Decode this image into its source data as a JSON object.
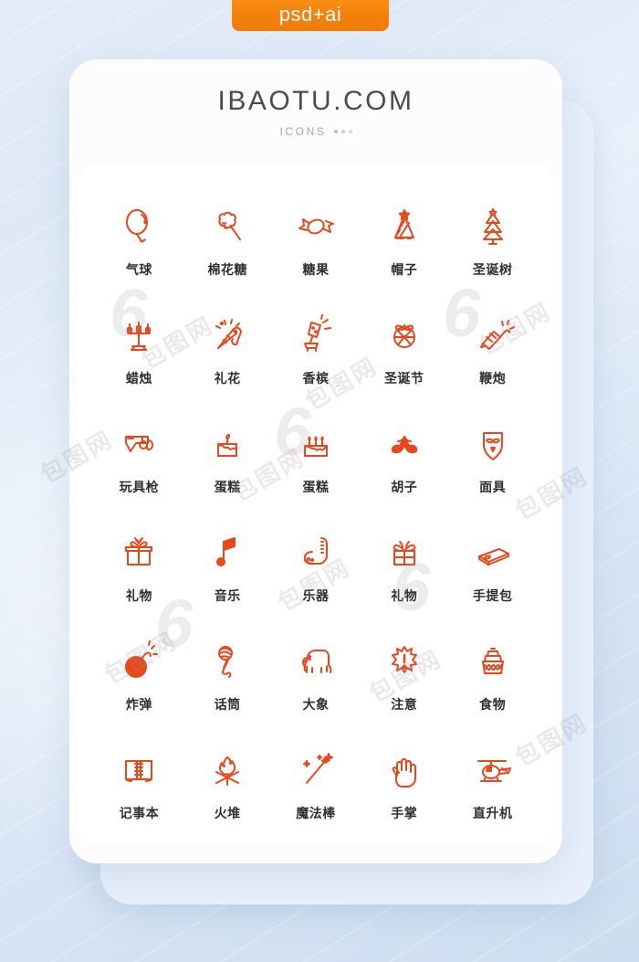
{
  "badge": {
    "label": "psd+ai",
    "color": "#f5820d"
  },
  "card": {
    "title": "IBAOTU.COM",
    "subtitle": "ICONS",
    "accent_color": "#e8481b",
    "title_color": "#4c4c4c"
  },
  "watermark": {
    "text": "包图网",
    "mark": "6"
  },
  "icons": [
    {
      "label": "气球",
      "name": "balloon-icon"
    },
    {
      "label": "棉花糖",
      "name": "cotton-candy-icon"
    },
    {
      "label": "糖果",
      "name": "candy-icon"
    },
    {
      "label": "帽子",
      "name": "party-hat-icon"
    },
    {
      "label": "圣诞树",
      "name": "christmas-tree-icon"
    },
    {
      "label": "蜡烛",
      "name": "candelabra-icon"
    },
    {
      "label": "礼花",
      "name": "party-popper-icon"
    },
    {
      "label": "香槟",
      "name": "champagne-icon"
    },
    {
      "label": "圣诞节",
      "name": "christmas-wreath-icon"
    },
    {
      "label": "鞭炮",
      "name": "firecracker-icon"
    },
    {
      "label": "玩具枪",
      "name": "toy-gun-icon"
    },
    {
      "label": "蛋糕",
      "name": "cake-icon"
    },
    {
      "label": "蛋糕",
      "name": "birthday-cake-icon"
    },
    {
      "label": "胡子",
      "name": "mustache-icon"
    },
    {
      "label": "面具",
      "name": "mask-icon"
    },
    {
      "label": "礼物",
      "name": "gift-box-icon"
    },
    {
      "label": "音乐",
      "name": "music-note-icon"
    },
    {
      "label": "乐器",
      "name": "saxophone-icon"
    },
    {
      "label": "礼物",
      "name": "gift-ribbon-icon"
    },
    {
      "label": "手提包",
      "name": "handbag-icon"
    },
    {
      "label": "炸弹",
      "name": "bomb-icon"
    },
    {
      "label": "话筒",
      "name": "microphone-icon"
    },
    {
      "label": "大象",
      "name": "elephant-icon"
    },
    {
      "label": "注意",
      "name": "attention-icon"
    },
    {
      "label": "食物",
      "name": "food-basket-icon"
    },
    {
      "label": "记事本",
      "name": "notebook-icon"
    },
    {
      "label": "火堆",
      "name": "bonfire-icon"
    },
    {
      "label": "魔法棒",
      "name": "magic-wand-icon"
    },
    {
      "label": "手掌",
      "name": "palm-hand-icon"
    },
    {
      "label": "直升机",
      "name": "helicopter-icon"
    }
  ]
}
